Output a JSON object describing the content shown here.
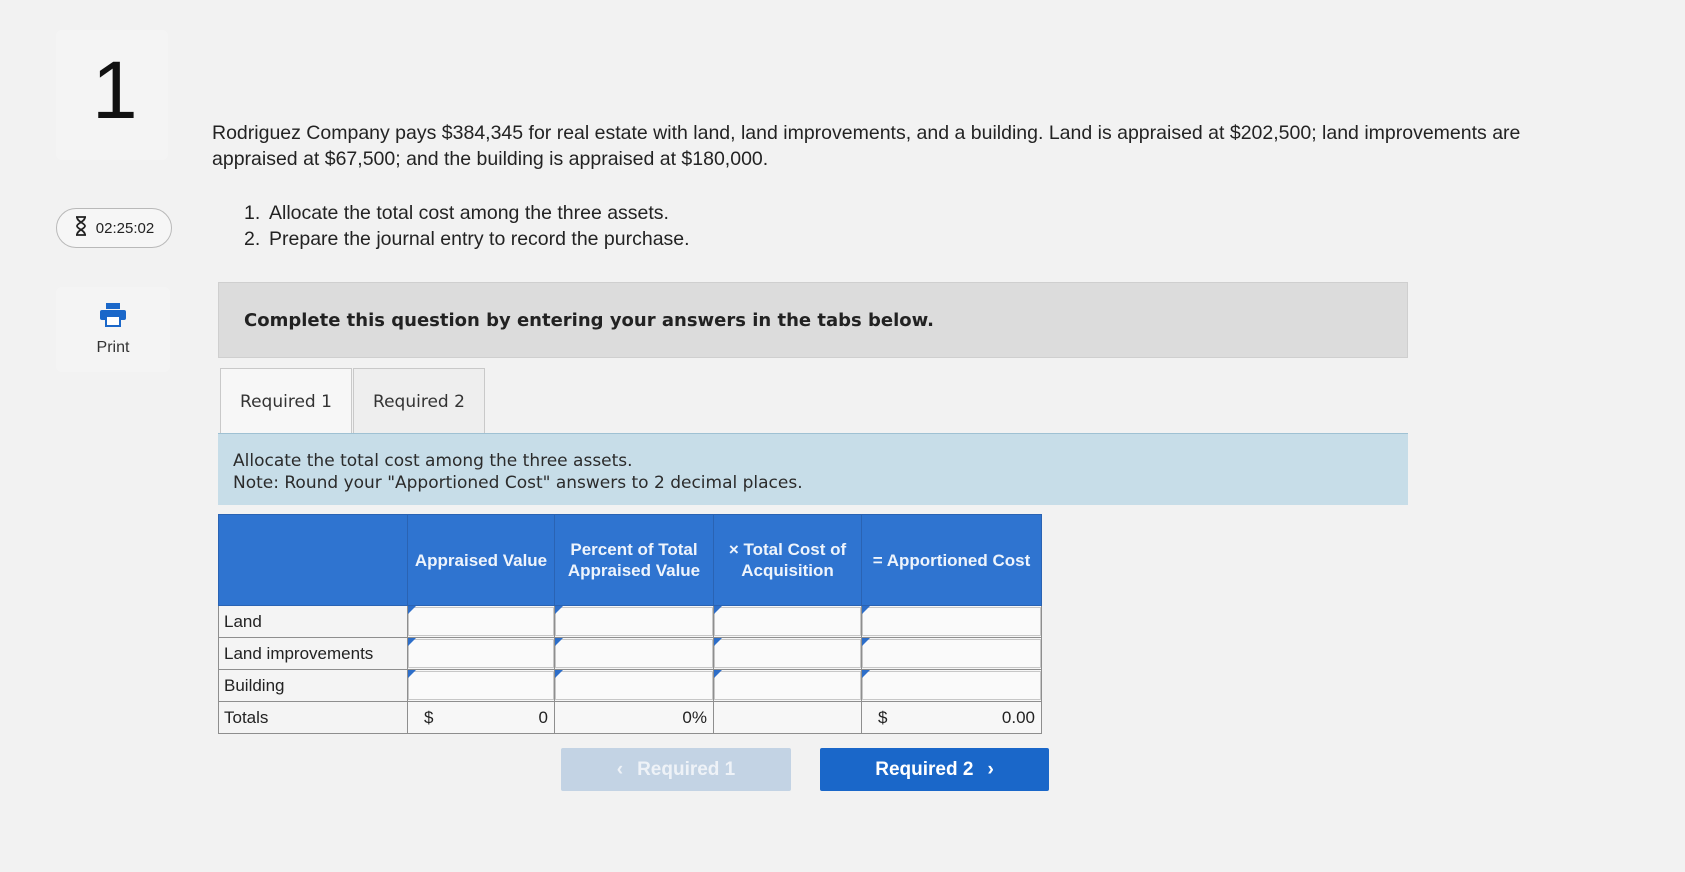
{
  "question": {
    "number": "1"
  },
  "timer": {
    "value": "02:25:02",
    "icon": "hourglass-icon"
  },
  "print": {
    "label": "Print",
    "icon": "printer-icon"
  },
  "problem": {
    "text": "Rodriguez Company pays $384,345 for real estate with land, land improvements, and a building. Land is appraised at $202,500; land improvements are appraised at $67,500; and the building is appraised at $180,000.",
    "steps": [
      {
        "num": "1.",
        "text": "Allocate the total cost among the three assets."
      },
      {
        "num": "2.",
        "text": "Prepare the journal entry to record the purchase."
      }
    ]
  },
  "banner": {
    "text": "Complete this question by entering your answers in the tabs below."
  },
  "tabs": [
    {
      "label": "Required 1",
      "active": true
    },
    {
      "label": "Required 2",
      "active": false
    }
  ],
  "instructions": {
    "line1": "Allocate the total cost among the three assets.",
    "line2": "Note: Round your \"Apportioned Cost\" answers to 2 decimal places."
  },
  "table": {
    "headers": [
      "",
      "Appraised Value",
      "Percent of Total Appraised Value",
      "× Total Cost of Acquisition",
      "= Apportioned Cost"
    ],
    "rows": [
      {
        "label": "Land",
        "values": [
          "",
          "",
          "",
          ""
        ]
      },
      {
        "label": "Land improvements",
        "values": [
          "",
          "",
          "",
          ""
        ]
      },
      {
        "label": "Building",
        "values": [
          "",
          "",
          "",
          ""
        ]
      }
    ],
    "totals": {
      "label": "Totals",
      "appraised_currency": "$",
      "appraised_value": "0",
      "percent": "0%",
      "apportioned_currency": "$",
      "apportioned_value": "0.00"
    }
  },
  "nav": {
    "prev_label": "Required 1",
    "next_label": "Required 2"
  },
  "colors": {
    "header_blue": "#2f74d0",
    "button_blue": "#1a67c9",
    "instruction_bg": "#c7dde8"
  }
}
